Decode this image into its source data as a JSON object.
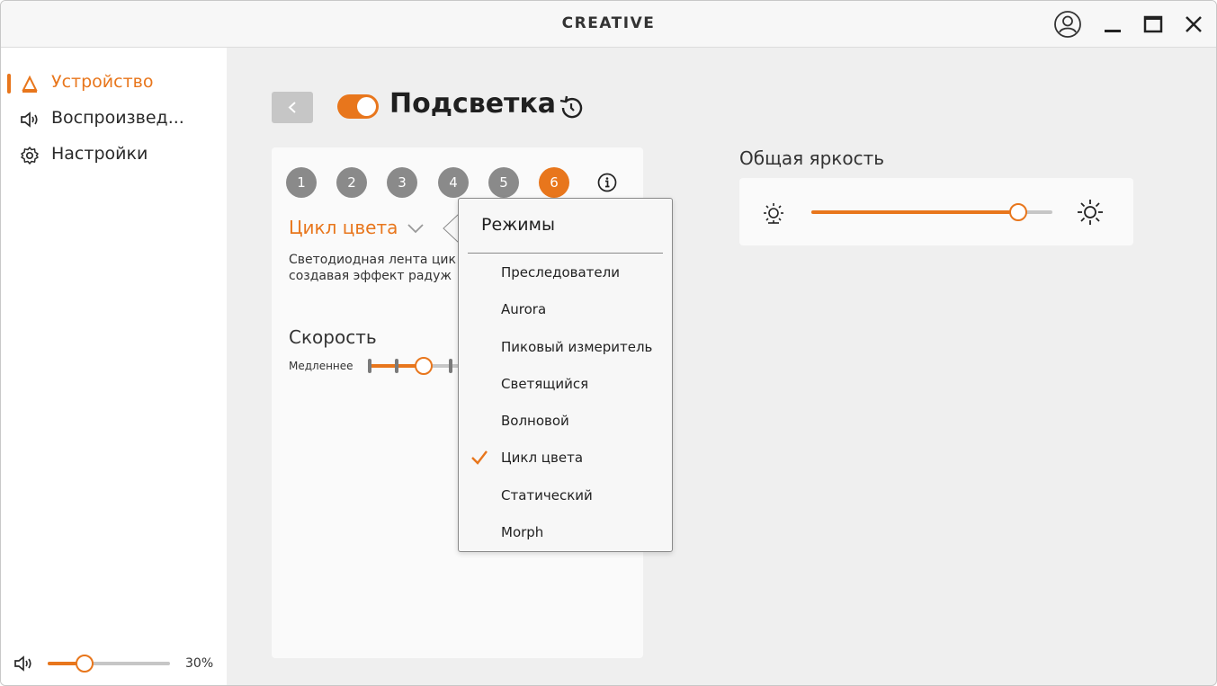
{
  "titlebar": {
    "brand": "CREATIVE"
  },
  "sidebar": {
    "items": [
      {
        "label": "Устройство",
        "icon": "device-icon",
        "active": true
      },
      {
        "label": "Воспроизвед...",
        "icon": "speaker-icon",
        "active": false
      },
      {
        "label": "Настройки",
        "icon": "gear-icon",
        "active": false
      }
    ],
    "volume": {
      "value": 30,
      "label": "30%"
    }
  },
  "header": {
    "title": "Подсветка",
    "lighting_enabled": true
  },
  "zones": {
    "labels": [
      "1",
      "2",
      "3",
      "4",
      "5",
      "6"
    ],
    "selected": "6"
  },
  "mode": {
    "current": "Цикл цвета",
    "description_line1": "Светодиодная лента цик",
    "description_line2": "создавая эффект радуж"
  },
  "speed": {
    "label": "Скорость",
    "min_label": "Медленнее",
    "value_fraction": 0.6
  },
  "brightness": {
    "label": "Общая яркость",
    "value_fraction": 0.86
  },
  "dropdown": {
    "header": "Режимы",
    "items": [
      {
        "label": "Преследователи",
        "checked": false
      },
      {
        "label": "Aurora",
        "checked": false
      },
      {
        "label": "Пиковый измеритель",
        "checked": false
      },
      {
        "label": "Светящийся",
        "checked": false
      },
      {
        "label": "Волновой",
        "checked": false
      },
      {
        "label": "Цикл цвета",
        "checked": true
      },
      {
        "label": "Статический",
        "checked": false
      },
      {
        "label": "Morph",
        "checked": false
      }
    ]
  },
  "colors": {
    "accent": "#e8761c",
    "zone_inactive": "#8a8a8a",
    "track": "#c6c6c6"
  }
}
